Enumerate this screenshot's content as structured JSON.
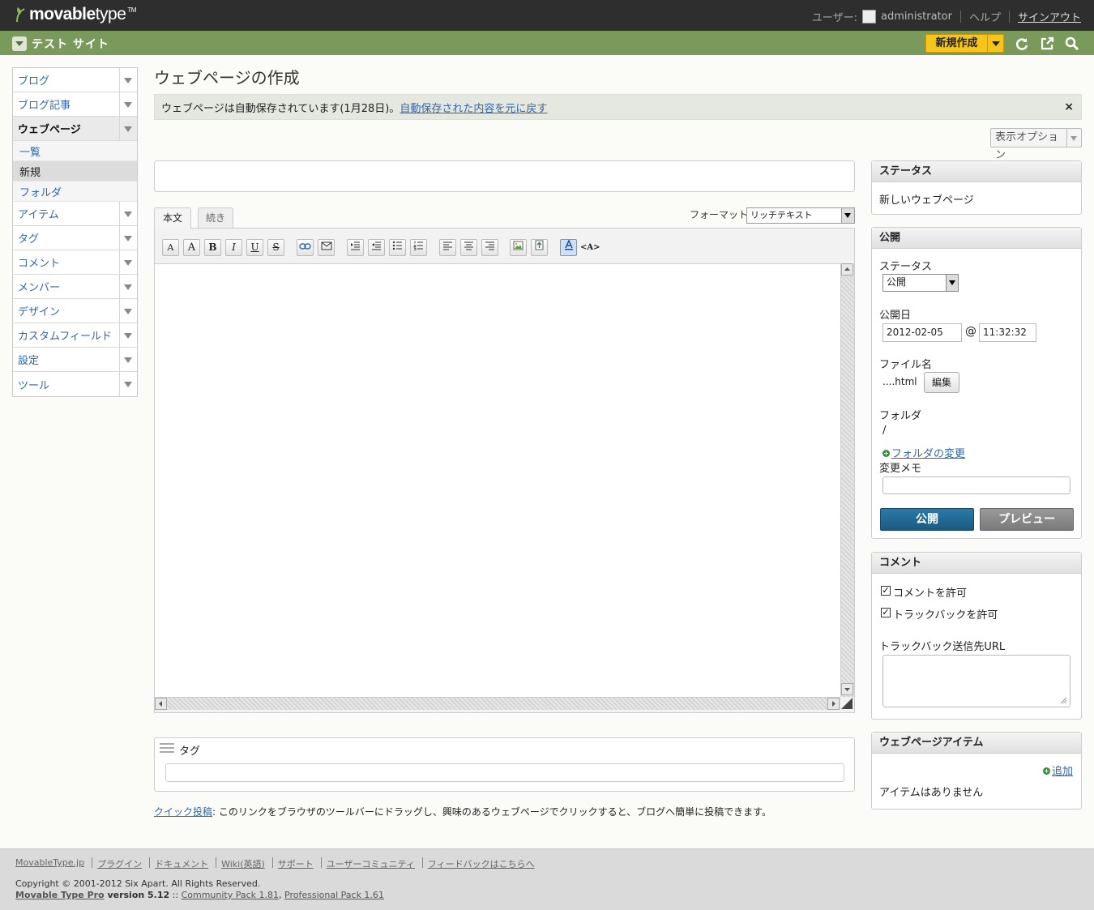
{
  "app": {
    "logo_bold": "movable",
    "logo_light": "type",
    "logo_tm": "TM"
  },
  "user": {
    "label": "ユーザー:",
    "name": "administrator",
    "help": "ヘルプ",
    "signout": "サインアウト"
  },
  "site": {
    "name": "テスト サイト",
    "new_button": "新規作成"
  },
  "nav": {
    "items": [
      {
        "label": "ブログ"
      },
      {
        "label": "ブログ記事"
      },
      {
        "label": "ウェブページ"
      },
      {
        "label": "アイテム"
      },
      {
        "label": "タグ"
      },
      {
        "label": "コメント"
      },
      {
        "label": "メンバー"
      },
      {
        "label": "デザイン"
      },
      {
        "label": "カスタムフィールド"
      },
      {
        "label": "設定"
      },
      {
        "label": "ツール"
      }
    ],
    "sub": [
      {
        "label": "一覧"
      },
      {
        "label": "新規"
      },
      {
        "label": "フォルダ"
      }
    ]
  },
  "main": {
    "title": "ウェブページの作成",
    "autosave_text": "ウェブページは自動保存されています(1月28日)。",
    "autosave_link": "自動保存された内容を元に戻す",
    "close": "×",
    "display_options": "表示オプション",
    "tabs": [
      {
        "label": "本文"
      },
      {
        "label": "続き"
      }
    ],
    "format_label": "フォーマット:",
    "format_value": "リッチテキスト",
    "tags_label": "タグ",
    "quickpost_link": "クイック投稿",
    "quickpost_text": ": このリンクをブラウザのツールバーにドラッグし、興味のあるウェブページでクリックすると、ブログへ簡単に投稿できます。"
  },
  "toolbar": {
    "font_smaller": "A",
    "font_larger": "A",
    "bold": "B",
    "italic": "I",
    "underline": "U",
    "strike": "S",
    "html_mode": "<A>"
  },
  "status_widget": {
    "title": "ステータス",
    "value": "新しいウェブページ"
  },
  "publish_widget": {
    "title": "公開",
    "status_label": "ステータス",
    "status_value": "公開",
    "date_label": "公開日",
    "date_value": "2012-02-05",
    "at": "@",
    "time_value": "11:32:32",
    "filename_label": "ファイル名",
    "filename_value": "....html",
    "edit_button": "編集",
    "folder_label": "フォルダ",
    "folder_value": "/",
    "change_folder": "フォルダの変更",
    "memo_label": "変更メモ",
    "publish_button": "公開",
    "preview_button": "プレビュー"
  },
  "comment_widget": {
    "title": "コメント",
    "allow_comments": "コメントを許可",
    "allow_trackbacks": "トラックバックを許可",
    "allow_comments_checked": true,
    "allow_trackbacks_checked": true,
    "check_mark": "✓",
    "trackback_url_label": "トラックバック送信先URL"
  },
  "assets_widget": {
    "title": "ウェブページアイテム",
    "add": "追加",
    "empty": "アイテムはありません"
  },
  "footer": {
    "links": [
      {
        "label": "MovableType.jp"
      },
      {
        "label": "プラグイン"
      },
      {
        "label": "ドキュメント"
      },
      {
        "label": "Wiki(英語)"
      },
      {
        "label": "サポート"
      },
      {
        "label": "ユーザーコミュニティ"
      },
      {
        "label": "フィードバックはこちらへ"
      }
    ],
    "copyright": "Copyright © 2001-2012 Six Apart. All Rights Reserved.",
    "product": "Movable Type Pro",
    "version": " version 5.12",
    "sep": " :: ",
    "community_pack": "Community Pack 1.81",
    "comma": ", ",
    "professional_pack": "Professional Pack 1.61"
  },
  "colors": {
    "topbar": "#2e2e2e",
    "sitebar": "#7a9a5c",
    "new_button": "#f5c51e",
    "publish_button": "#1b5a82",
    "link": "#3366aa"
  }
}
